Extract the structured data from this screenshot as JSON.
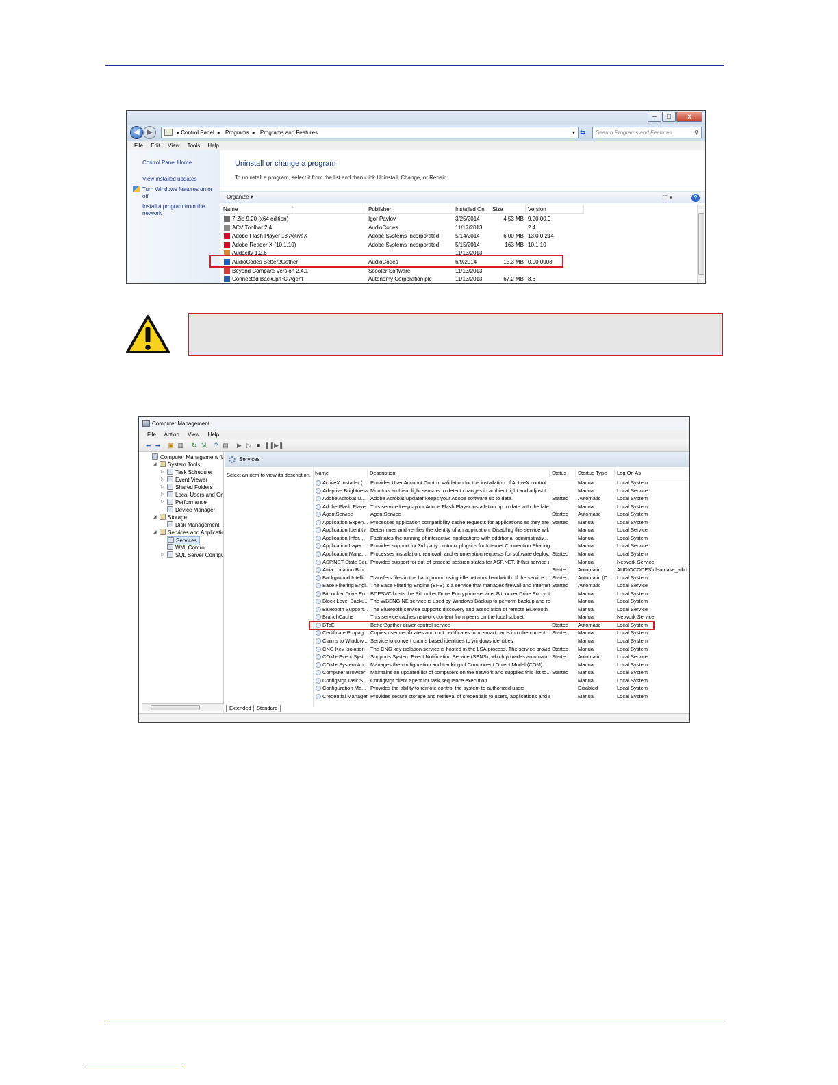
{
  "programs_window": {
    "title_buttons": {
      "minimize": "–",
      "maximize": "□",
      "close": "x"
    },
    "breadcrumb": [
      "Control Panel",
      "Programs",
      "Programs and Features"
    ],
    "search_placeholder": "Search Programs and Features",
    "menu": [
      "File",
      "Edit",
      "View",
      "Tools",
      "Help"
    ],
    "tasks": {
      "home": "Control Panel Home",
      "updates": "View installed updates",
      "features": "Turn Windows features on or off",
      "network": "Install a program from the network"
    },
    "heading": "Uninstall or change a program",
    "subheading": "To uninstall a program, select it from the list and then click Uninstall, Change, or Repair.",
    "organize": "Organize",
    "columns": [
      "Name",
      "Publisher",
      "Installed On",
      "Size",
      "Version"
    ],
    "rows": [
      {
        "name": "7-Zip 9.20 (x64 edition)",
        "publisher": "Igor Pavlov",
        "installed": "3/25/2014",
        "size": "4.53 MB",
        "version": "9.20.00.0",
        "icon_color": "#6b6b6b"
      },
      {
        "name": "ACVIToolbar 2.4",
        "publisher": "AudioCodes",
        "installed": "11/17/2013",
        "size": "",
        "version": "2.4",
        "icon_color": "#8a8a8a"
      },
      {
        "name": "Adobe Flash Player 13 ActiveX",
        "publisher": "Adobe Systems Incorporated",
        "installed": "5/14/2014",
        "size": "6.00 MB",
        "version": "13.0.0.214",
        "icon_color": "#c8102e"
      },
      {
        "name": "Adobe Reader X (10.1.10)",
        "publisher": "Adobe Systems Incorporated",
        "installed": "5/15/2014",
        "size": "163 MB",
        "version": "10.1.10",
        "icon_color": "#c8102e"
      },
      {
        "name": "Audacity 1.2.6",
        "publisher": "",
        "installed": "11/13/2013",
        "size": "",
        "version": "",
        "icon_color": "#d98b2b"
      },
      {
        "name": "AudioCodes Better2Gether",
        "publisher": "AudioCodes",
        "installed": "6/9/2014",
        "size": "15.3 MB",
        "version": "0.00.0003",
        "icon_color": "#2a5fb0"
      },
      {
        "name": "Beyond Compare Version 2.4.1",
        "publisher": "Scooter Software",
        "installed": "11/13/2013",
        "size": "",
        "version": "",
        "icon_color": "#d4403a"
      },
      {
        "name": "Connected Backup/PC Agent",
        "publisher": "Autonomy Corporation plc",
        "installed": "11/13/2013",
        "size": "67.2 MB",
        "version": "8.6",
        "icon_color": "#2a5fb0"
      }
    ]
  },
  "mgmt_window": {
    "title": "Computer Management",
    "menu": [
      "File",
      "Action",
      "View",
      "Help"
    ],
    "tree": [
      {
        "label": "Computer Management (Local",
        "level": 0,
        "twisty": ""
      },
      {
        "label": "System Tools",
        "level": 1,
        "twisty": "◢"
      },
      {
        "label": "Task Scheduler",
        "level": 2,
        "twisty": "▷"
      },
      {
        "label": "Event Viewer",
        "level": 2,
        "twisty": "▷"
      },
      {
        "label": "Shared Folders",
        "level": 2,
        "twisty": "▷"
      },
      {
        "label": "Local Users and Groups",
        "level": 2,
        "twisty": "▷"
      },
      {
        "label": "Performance",
        "level": 2,
        "twisty": "▷"
      },
      {
        "label": "Device Manager",
        "level": 2,
        "twisty": ""
      },
      {
        "label": "Storage",
        "level": 1,
        "twisty": "◢"
      },
      {
        "label": "Disk Management",
        "level": 2,
        "twisty": ""
      },
      {
        "label": "Services and Applications",
        "level": 1,
        "twisty": "◢"
      },
      {
        "label": "Services",
        "level": 2,
        "twisty": "",
        "selected": true
      },
      {
        "label": "WMI Control",
        "level": 2,
        "twisty": ""
      },
      {
        "label": "SQL Server Configuratic",
        "level": 2,
        "twisty": "▷"
      }
    ],
    "pane_title": "Services",
    "select_hint": "Select an item to view its description.",
    "columns": [
      "Name",
      "Description",
      "Status",
      "Startup Type",
      "Log On As"
    ],
    "tabs": [
      "Extended",
      "Standard"
    ],
    "services": [
      {
        "name": "ActiveX Installer (...",
        "desc": "Provides User Account Control validation for the installation of ActiveX control...",
        "status": "",
        "startup": "Manual",
        "logon": "Local System"
      },
      {
        "name": "Adaptive Brightness",
        "desc": "Monitors ambient light sensors to detect changes in ambient light and adjust t...",
        "status": "",
        "startup": "Manual",
        "logon": "Local Service"
      },
      {
        "name": "Adobe Acrobat U...",
        "desc": "Adobe Acrobat Updater keeps your Adobe software up to date.",
        "status": "Started",
        "startup": "Automatic",
        "logon": "Local System"
      },
      {
        "name": "Adobe Flash Playe...",
        "desc": "This service keeps your Adobe Flash Player installation up to date with the late...",
        "status": "",
        "startup": "Manual",
        "logon": "Local System"
      },
      {
        "name": "AgentService",
        "desc": "AgentService",
        "status": "Started",
        "startup": "Automatic",
        "logon": "Local System"
      },
      {
        "name": "Application Expen...",
        "desc": "Processes application compatibility cache requests for applications as they are ...",
        "status": "Started",
        "startup": "Manual",
        "logon": "Local System"
      },
      {
        "name": "Application Identity",
        "desc": "Determines and verifies the identity of an application. Disabling this service wil...",
        "status": "",
        "startup": "Manual",
        "logon": "Local Service"
      },
      {
        "name": "Application Infor...",
        "desc": "Facilitates the running of interactive applications with additional administrativ...",
        "status": "",
        "startup": "Manual",
        "logon": "Local System"
      },
      {
        "name": "Application Layer...",
        "desc": "Provides support for 3rd party protocol plug-ins for Internet Connection Sharing",
        "status": "",
        "startup": "Manual",
        "logon": "Local Service"
      },
      {
        "name": "Application Mana...",
        "desc": "Processes installation, removal, and enumeration requests for software deploy...",
        "status": "Started",
        "startup": "Manual",
        "logon": "Local System"
      },
      {
        "name": "ASP.NET State Ser...",
        "desc": "Provides support for out-of-process session states for ASP.NET. If this service i...",
        "status": "",
        "startup": "Manual",
        "logon": "Network Service"
      },
      {
        "name": "Atria Location Bro...",
        "desc": "",
        "status": "Started",
        "startup": "Automatic",
        "logon": "AUDIOCODES\\clearcase_albd"
      },
      {
        "name": "Background Intelli...",
        "desc": "Transfers files in the background using idle network bandwidth. If the service i...",
        "status": "Started",
        "startup": "Automatic (D...",
        "logon": "Local System"
      },
      {
        "name": "Base Filtering Engi...",
        "desc": "The Base Filtering Engine (BFE) is a service that manages firewall and Internet P...",
        "status": "Started",
        "startup": "Automatic",
        "logon": "Local Service"
      },
      {
        "name": "BitLocker Drive En...",
        "desc": "BDESVC hosts the BitLocker Drive Encryption service. BitLocker Drive Encryptio...",
        "status": "",
        "startup": "Manual",
        "logon": "Local System"
      },
      {
        "name": "Block Level Backu...",
        "desc": "The WBENGINE service is used by Windows Backup to perform backup and rec...",
        "status": "",
        "startup": "Manual",
        "logon": "Local System"
      },
      {
        "name": "Bluetooth Support...",
        "desc": "The Bluetooth service supports discovery and association of remote Bluetooth ...",
        "status": "",
        "startup": "Manual",
        "logon": "Local Service"
      },
      {
        "name": "BranchCache",
        "desc": "This service caches network content from peers on the local subnet.",
        "status": "",
        "startup": "Manual",
        "logon": "Network Service"
      },
      {
        "name": "BToE",
        "desc": "Better2gether driver control service",
        "status": "Started",
        "startup": "Automatic",
        "logon": "Local System"
      },
      {
        "name": "Certificate Propag...",
        "desc": "Copies user certificates and root certificates from smart cards into the current ...",
        "status": "Started",
        "startup": "Manual",
        "logon": "Local System"
      },
      {
        "name": "Claims to Window...",
        "desc": "Service to convert claims based identities to windows identities",
        "status": "",
        "startup": "Manual",
        "logon": "Local System"
      },
      {
        "name": "CNG Key Isolation",
        "desc": "The CNG key isolation service is hosted in the LSA process. The service provide...",
        "status": "Started",
        "startup": "Manual",
        "logon": "Local System"
      },
      {
        "name": "COM+ Event Syst...",
        "desc": "Supports System Event Notification Service (SENS), which provides automatic ...",
        "status": "Started",
        "startup": "Automatic",
        "logon": "Local Service"
      },
      {
        "name": "COM+ System Ap...",
        "desc": "Manages the configuration and tracking of Component Object Model (COM)...",
        "status": "",
        "startup": "Manual",
        "logon": "Local System"
      },
      {
        "name": "Computer Browser",
        "desc": "Maintains an updated list of computers on the network and supplies this list to...",
        "status": "Started",
        "startup": "Manual",
        "logon": "Local System"
      },
      {
        "name": "ConfigMgr Task S...",
        "desc": "ConfigMgr client agent for task sequence execution",
        "status": "",
        "startup": "Manual",
        "logon": "Local System"
      },
      {
        "name": "Configuration Ma...",
        "desc": "Provides the ability to remote control the system to authorized users",
        "status": "",
        "startup": "Disabled",
        "logon": "Local System"
      },
      {
        "name": "Credential Manager",
        "desc": "Provides secure storage and retrieval of credentials to users, applications and s...",
        "status": "",
        "startup": "Manual",
        "logon": "Local System"
      }
    ]
  },
  "colors": {
    "highlight": "#d1202a",
    "rule": "#1f2f8f",
    "link": "#1e3287"
  }
}
